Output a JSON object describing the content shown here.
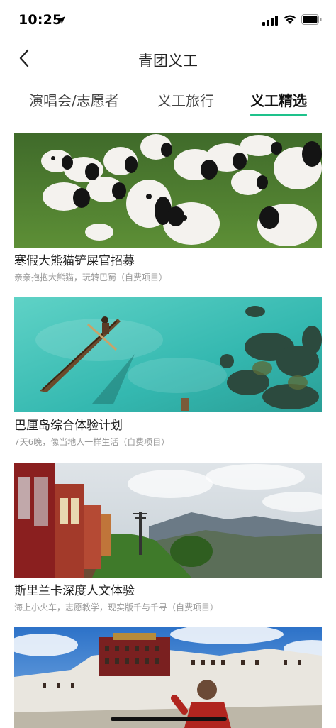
{
  "status_bar": {
    "time": "10:25"
  },
  "nav": {
    "title": "青团义工",
    "back_icon": "chevron-left-icon"
  },
  "tabs": [
    {
      "label": "演唱会/志愿者",
      "active": false
    },
    {
      "label": "义工旅行",
      "active": false
    },
    {
      "label": "义工精选",
      "active": true
    }
  ],
  "colors": {
    "accent": "#1ec28b"
  },
  "cards": [
    {
      "title": "寒假大熊猫铲屎官招募",
      "subtitle": "亲亲抱抱大熊猫，玩转巴蜀（自费项目）",
      "image": "panda-cubs-photo"
    },
    {
      "title": "巴厘岛综合体验计划",
      "subtitle": "7天6晚，像当地人一样生活（自费项目）",
      "image": "bali-canoe-photo"
    },
    {
      "title": "斯里兰卡深度人文体验",
      "subtitle": "海上小火车，志愿教学，现实版千与千寻（自费项目）",
      "image": "sri-lanka-train-photo"
    },
    {
      "title": "",
      "subtitle": "",
      "image": "potala-palace-photo"
    }
  ]
}
